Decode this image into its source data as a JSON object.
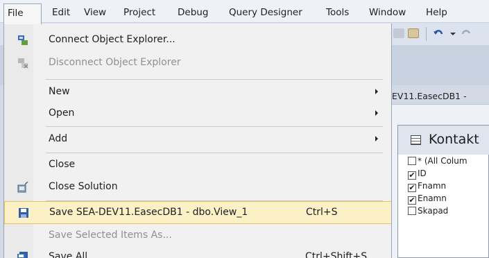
{
  "menubar": [
    "File",
    "Edit",
    "View",
    "Project",
    "Debug",
    "Query Designer",
    "Tools",
    "Window",
    "Help"
  ],
  "file_menu": {
    "connect_object_explorer": "Connect Object Explorer...",
    "disconnect_object_explorer": "Disconnect Object Explorer",
    "new": "New",
    "open": "Open",
    "add": "Add",
    "close": "Close",
    "close_solution": "Close Solution",
    "save": "Save SEA-DEV11.EasecDB1 - dbo.View_1",
    "save_shortcut": "Ctrl+S",
    "save_selected_items_as": "Save Selected Items As...",
    "save_all": "Save All",
    "save_all_shortcut": "Ctrl+Shift+S"
  },
  "document": {
    "tab_title": "EV11.EasecDB1 - ",
    "table_title": "Kontakt",
    "fields": [
      {
        "name": "* (All Colum",
        "checked": false
      },
      {
        "name": "ID",
        "checked": true
      },
      {
        "name": "Fnamn",
        "checked": true
      },
      {
        "name": "Enamn",
        "checked": true
      },
      {
        "name": "Skapad",
        "checked": false
      }
    ]
  },
  "colors": {
    "menu_highlight": "#fcf0c7",
    "menu_highlight_border": "#e5c365",
    "disabled_text": "#8f8f8f",
    "menubar_bg": "#eef2f8"
  }
}
